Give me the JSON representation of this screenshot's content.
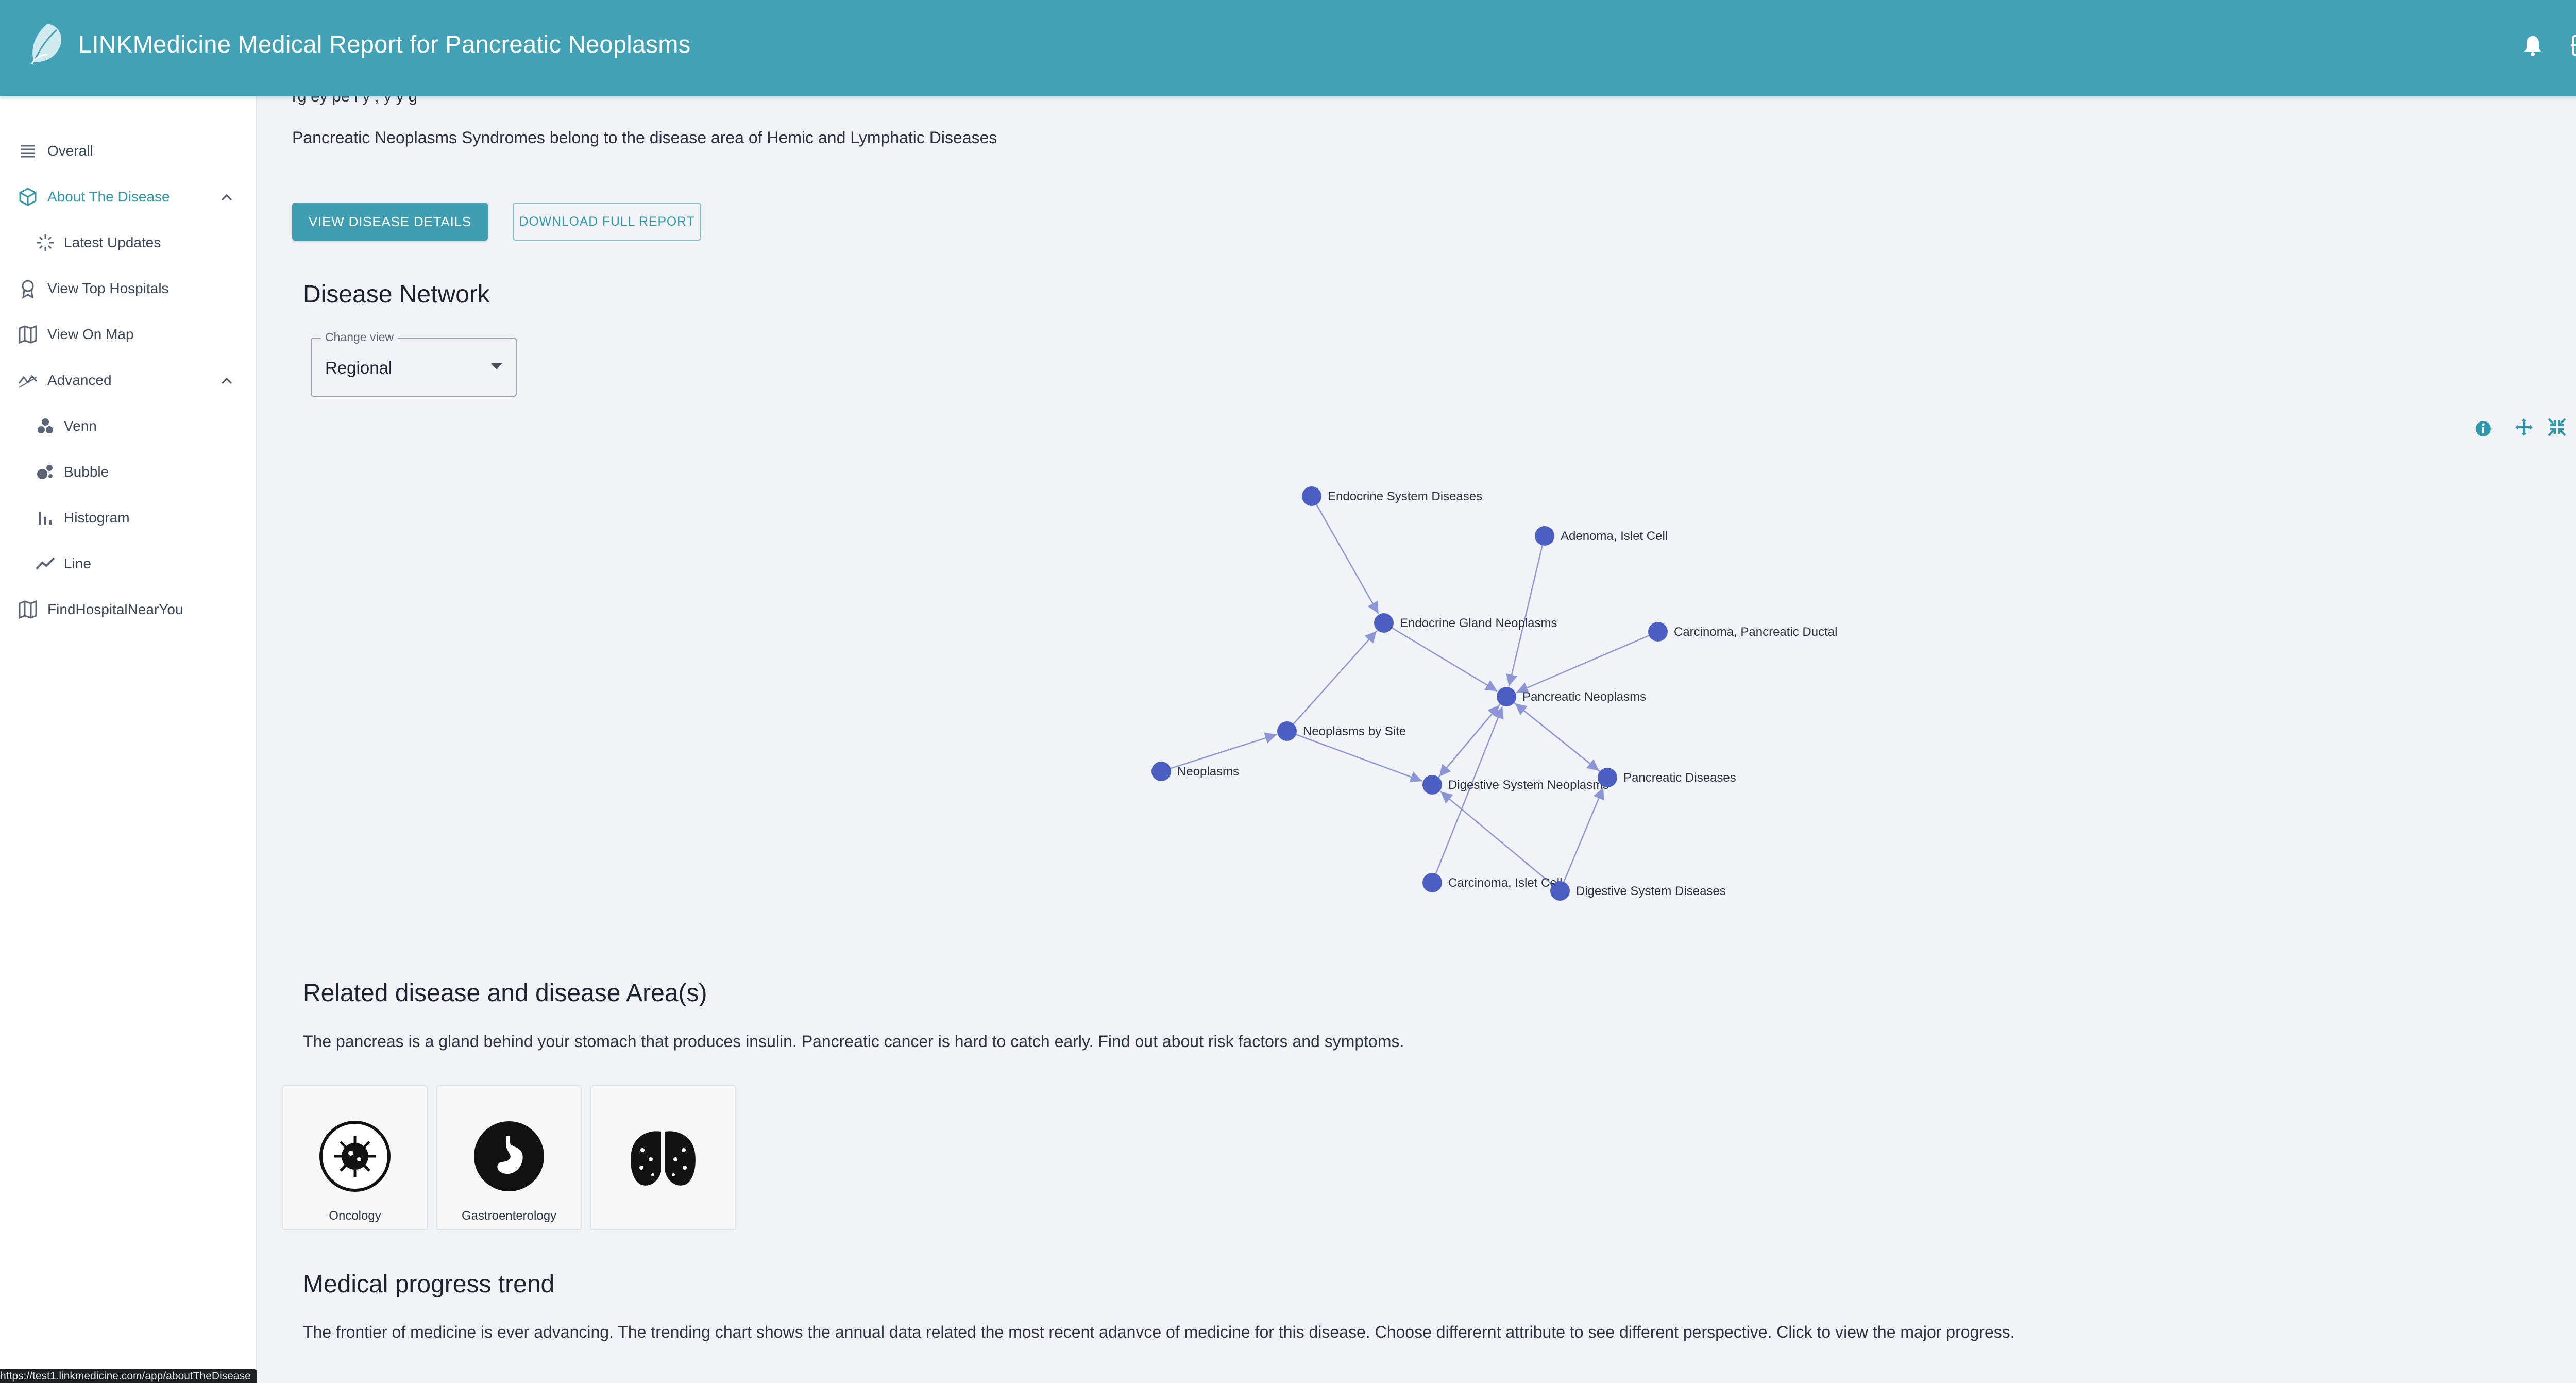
{
  "header": {
    "title": "LINKMedicine Medical Report for Pancreatic Neoplasms"
  },
  "sidebar": {
    "items": [
      {
        "label": "Overall",
        "icon": "list-icon"
      },
      {
        "label": "About The Disease",
        "icon": "cube-icon",
        "expanded": true,
        "active": true
      },
      {
        "label": "Latest Updates",
        "icon": "loader-icon",
        "sub": true
      },
      {
        "label": "View Top Hospitals",
        "icon": "award-icon"
      },
      {
        "label": "View On Map",
        "icon": "map-icon"
      },
      {
        "label": "Advanced",
        "icon": "trend-icon",
        "expanded": true
      },
      {
        "label": "Venn",
        "icon": "venn-icon",
        "sub": true
      },
      {
        "label": "Bubble",
        "icon": "bubble-icon",
        "sub": true
      },
      {
        "label": "Histogram",
        "icon": "bar-chart-icon",
        "sub": true
      },
      {
        "label": "Line",
        "icon": "line-chart-icon",
        "sub": true
      },
      {
        "label": "FindHospitalNearYou",
        "icon": "map-icon"
      }
    ]
  },
  "main": {
    "truncated_text": "rg ey  pe      l   y   ,    y  y   g",
    "disease_area_text": "Pancreatic Neoplasms Syndromes belong to the disease area of Hemic and Lymphatic Diseases",
    "view_details_label": "VIEW DISEASE DETAILS",
    "download_label": "DOWNLOAD FULL REPORT",
    "network_heading": "Disease Network",
    "change_view": {
      "legend": "Change view",
      "value": "Regional"
    },
    "related_heading": "Related disease and disease Area(s)",
    "related_text": "The pancreas is a gland behind your stomach that produces insulin. Pancreatic cancer is hard to catch early. Find out about risk factors and symptoms.",
    "related_cards": [
      {
        "label": "Oncology",
        "icon": "virus-icon"
      },
      {
        "label": "Gastroenterology",
        "icon": "stomach-icon"
      },
      {
        "label": "",
        "icon": "lungs-icon"
      }
    ],
    "progress_heading": "Medical progress trend",
    "progress_text": "The frontier of medicine is ever advancing. The trending chart shows the annual data related the most recent adanvce of medicine for this disease. Choose differernt attribute to see different perspective. Click to view the major progress."
  },
  "network": {
    "node_color": "#4a5fc1",
    "edge_color": "#8c96d6",
    "nodes": [
      {
        "id": "endo_sys",
        "label": "Endocrine System Diseases"
      },
      {
        "id": "adenoma",
        "label": "Adenoma, Islet Cell"
      },
      {
        "id": "endo_gland",
        "label": "Endocrine Gland Neoplasms"
      },
      {
        "id": "carc_duct",
        "label": "Carcinoma, Pancreatic Ductal"
      },
      {
        "id": "panc_neo",
        "label": "Pancreatic Neoplasms"
      },
      {
        "id": "neo_site",
        "label": "Neoplasms by Site"
      },
      {
        "id": "neoplasms",
        "label": "Neoplasms"
      },
      {
        "id": "dig_neo",
        "label": "Digestive System Neoplasms"
      },
      {
        "id": "panc_dis",
        "label": "Pancreatic Diseases"
      },
      {
        "id": "carc_islet",
        "label": "Carcinoma, Islet Cell"
      },
      {
        "id": "dig_sys",
        "label": "Digestive System Diseases"
      }
    ],
    "edges": [
      [
        "endo_sys",
        "endo_gland"
      ],
      [
        "adenoma",
        "panc_neo"
      ],
      [
        "endo_gland",
        "panc_neo"
      ],
      [
        "carc_duct",
        "panc_neo"
      ],
      [
        "neo_site",
        "endo_gland"
      ],
      [
        "neoplasms",
        "neo_site"
      ],
      [
        "neo_site",
        "dig_neo"
      ],
      [
        "panc_neo",
        "dig_neo"
      ],
      [
        "dig_neo",
        "panc_neo"
      ],
      [
        "panc_neo",
        "panc_dis"
      ],
      [
        "panc_dis",
        "panc_neo"
      ],
      [
        "carc_islet",
        "panc_neo"
      ],
      [
        "dig_sys",
        "panc_dis"
      ],
      [
        "dig_sys",
        "dig_neo"
      ]
    ]
  },
  "status_bar": {
    "url": "https://test1.linkmedicine.com/app/aboutTheDisease"
  }
}
